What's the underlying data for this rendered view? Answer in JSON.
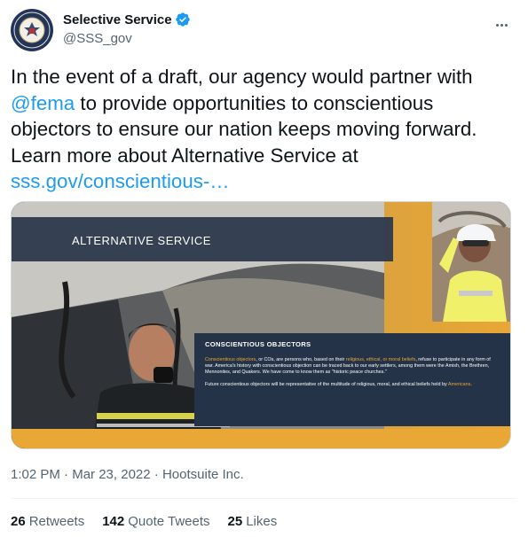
{
  "account": {
    "display_name": "Selective Service",
    "handle": "@SSS_gov",
    "verified": true,
    "avatar_icon": "seal-icon"
  },
  "tweet": {
    "text_part1": "In the event of a draft, our agency would partner with ",
    "mention": "@fema",
    "text_part2": " to provide opportunities to conscientious objectors to ensure our nation keeps moving forward. Learn more about Alternative Service at ",
    "link": "sss.gov/conscientious-…"
  },
  "media": {
    "banner_title": "ALTERNATIVE SERVICE",
    "box_title": "CONSCIENTIOUS OBJECTORS",
    "p1_hl1": "Conscientious objectors",
    "p1_a": ", or COs, are persons who, based on their ",
    "p1_hl2": "religious, ethical, or moral beliefs",
    "p1_b": ", refuse to participate in any form of war.  America's history with conscientious objection can be traced back to our early settlers, among them were the Amish, the Brethren,  Mennonites, and Quakers. We have come to know them as \"historic peace churches.\"",
    "p2_a": "Future conscientious objectors will be representative of the multitude of religious, moral, and ethical beliefs held by ",
    "p2_hl": "Americans",
    "p2_b": "."
  },
  "meta": {
    "time": "1:02 PM",
    "sep1": " · ",
    "date": "Mar 23, 2022",
    "sep2": " · ",
    "source": "Hootsuite Inc."
  },
  "stats": {
    "retweets_count": "26",
    "retweets_label": "Retweets",
    "quotes_count": "142",
    "quotes_label": "Quote Tweets",
    "likes_count": "25",
    "likes_label": "Likes"
  },
  "colors": {
    "link": "#1d9bf0",
    "accent_orange": "#e9a735",
    "navy": "#243347",
    "verified": "#1d9bf0"
  }
}
